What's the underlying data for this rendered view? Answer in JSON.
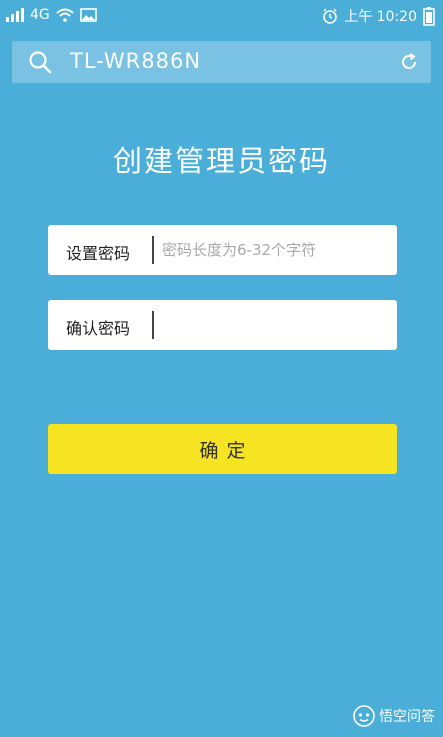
{
  "status_bar": {
    "network": "4G",
    "time": "上午 10:20"
  },
  "search": {
    "text": "TL-WR886N"
  },
  "page": {
    "title": "创建管理员密码"
  },
  "form": {
    "password_label": "设置密码",
    "password_placeholder": "密码长度为6-32个字符",
    "password_value": "",
    "confirm_label": "确认密码",
    "confirm_value": "",
    "submit_label": "确定"
  },
  "watermark": {
    "text": "悟空问答"
  },
  "icons": {
    "signal": "signal-icon",
    "wifi": "wifi-icon",
    "image": "image-notification-icon",
    "alarm": "alarm-icon",
    "battery": "battery-icon",
    "search": "search-icon",
    "refresh": "refresh-icon"
  },
  "colors": {
    "background": "#4aaed8",
    "search_bar": "#79c2e4",
    "button": "#f6e321"
  }
}
